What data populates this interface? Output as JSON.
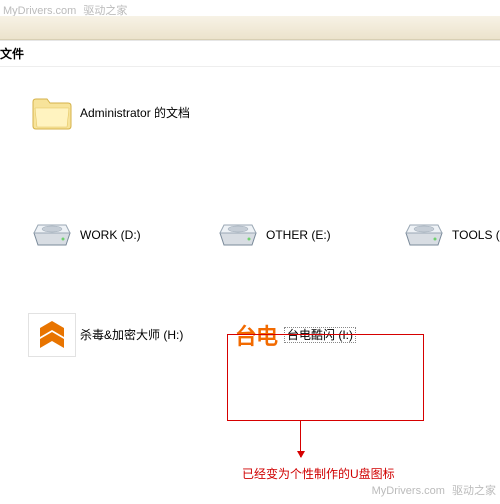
{
  "watermark_top": {
    "url": "MyDrivers.com",
    "cn": "驱动之家"
  },
  "watermark_bottom": {
    "url": "MyDrivers.com",
    "cn": "驱动之家"
  },
  "column_header": "文件",
  "items": {
    "admin_docs": {
      "label": "Administrator 的文档"
    },
    "work": {
      "label": "WORK (D:)"
    },
    "other": {
      "label": "OTHER (E:)"
    },
    "tools": {
      "label": "TOOLS (F:"
    },
    "anti": {
      "label": "杀毒&加密大师 (H:)"
    },
    "taidian": {
      "label": "台电酷闪 (I:)",
      "logo_text": "台电"
    }
  },
  "annotation": "已经变为个性制作的U盘图标"
}
